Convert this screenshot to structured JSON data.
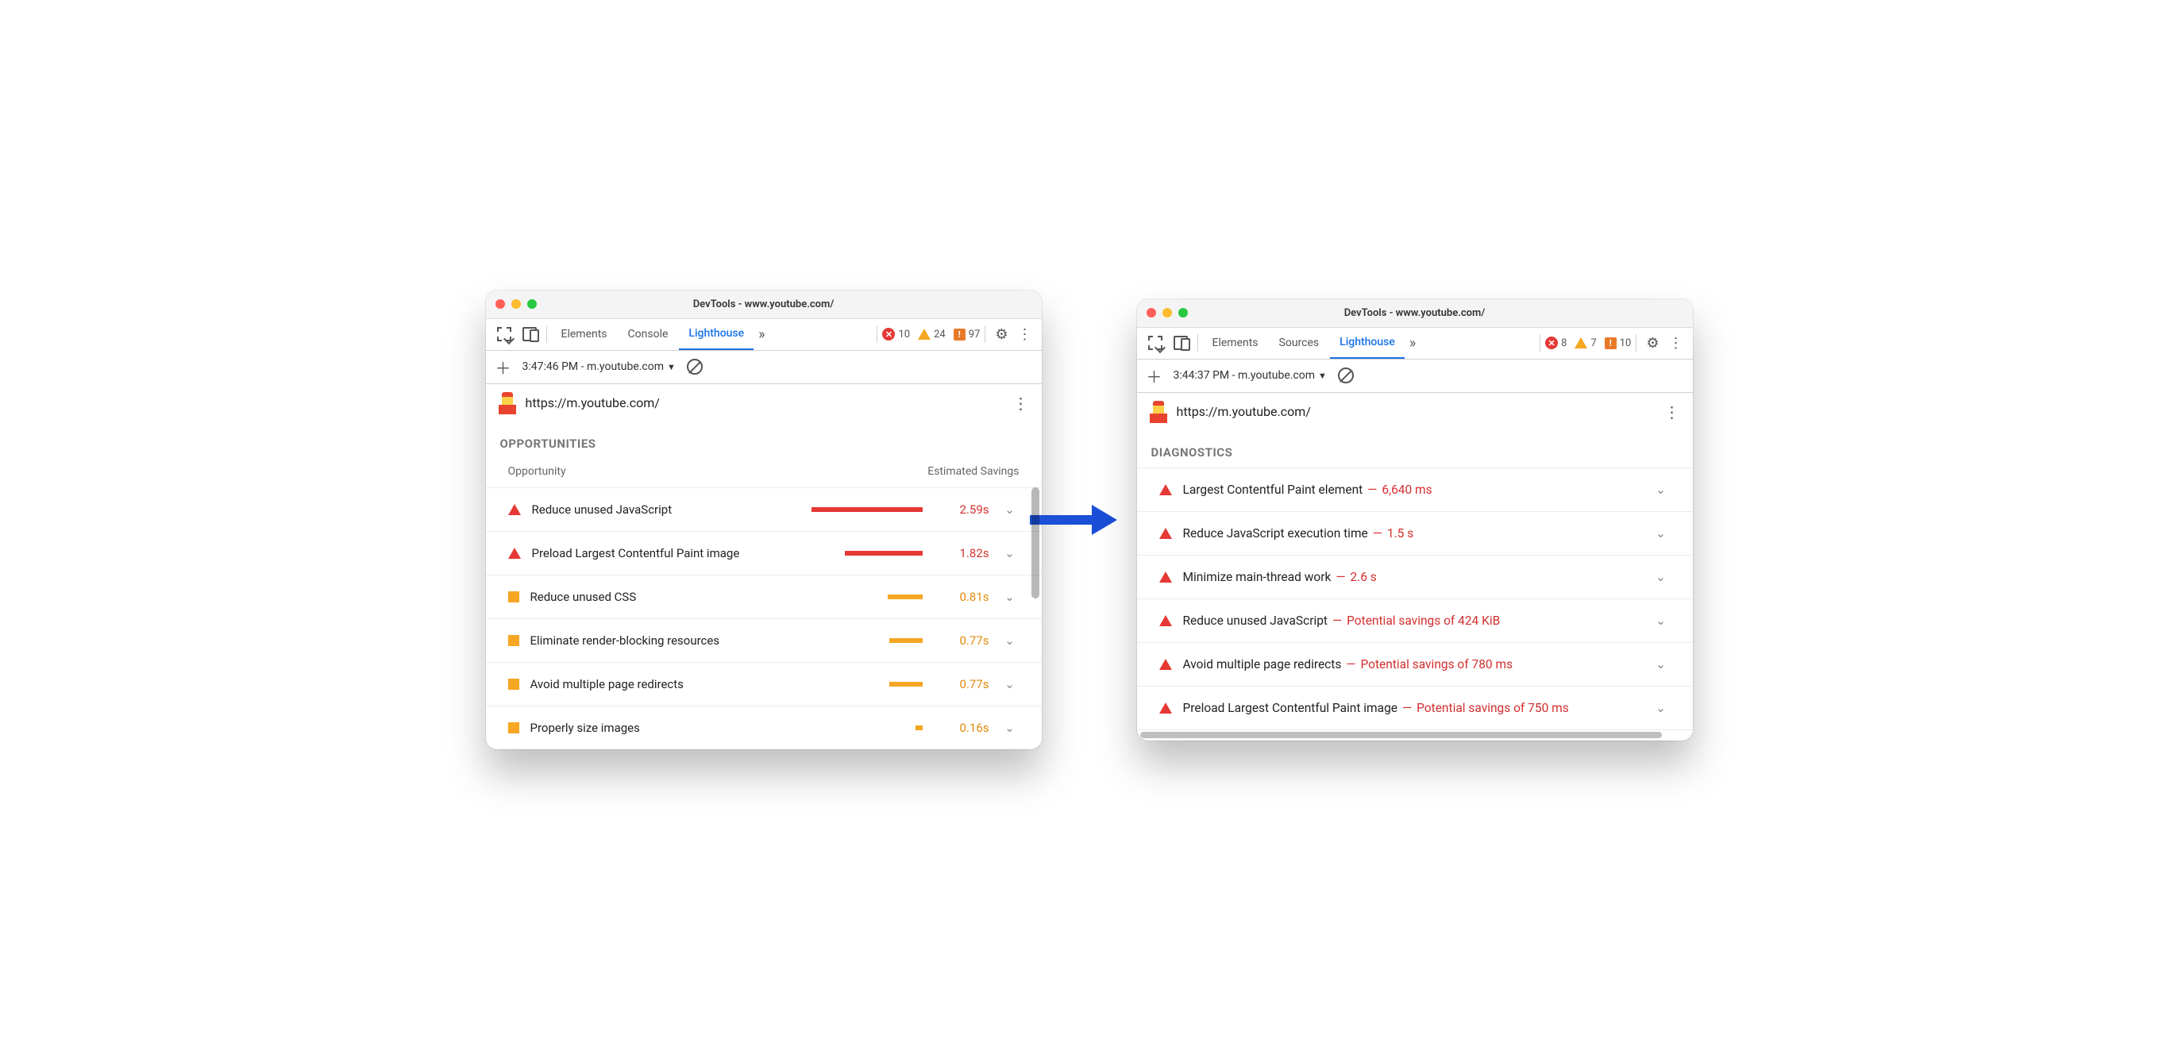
{
  "leftWindow": {
    "title": "DevTools - www.youtube.com/",
    "tabs": {
      "t1": "Elements",
      "t2": "Console",
      "t3": "Lighthouse"
    },
    "badges": {
      "errors": "10",
      "warnings": "24",
      "info": "97"
    },
    "run_label": "3:47:46 PM - m.youtube.com",
    "url": "https://m.youtube.com/",
    "section": "OPPORTUNITIES",
    "opp_head_left": "Opportunity",
    "opp_head_right": "Estimated Savings",
    "rows": [
      {
        "title": "Reduce unused JavaScript",
        "savings": "2.59s",
        "sev": "red",
        "barpct": 100
      },
      {
        "title": "Preload Largest Contentful Paint image",
        "savings": "1.82s",
        "sev": "red",
        "barpct": 70
      },
      {
        "title": "Reduce unused CSS",
        "savings": "0.81s",
        "sev": "or",
        "barpct": 31
      },
      {
        "title": "Eliminate render-blocking resources",
        "savings": "0.77s",
        "sev": "or",
        "barpct": 30
      },
      {
        "title": "Avoid multiple page redirects",
        "savings": "0.77s",
        "sev": "or",
        "barpct": 30
      },
      {
        "title": "Properly size images",
        "savings": "0.16s",
        "sev": "or",
        "barpct": 6
      }
    ]
  },
  "rightWindow": {
    "title": "DevTools - www.youtube.com/",
    "tabs": {
      "t1": "Elements",
      "t2": "Sources",
      "t3": "Lighthouse"
    },
    "badges": {
      "errors": "8",
      "warnings": "7",
      "info": "10"
    },
    "run_label": "3:44:37 PM - m.youtube.com",
    "url": "https://m.youtube.com/",
    "section": "DIAGNOSTICS",
    "rows": [
      {
        "title": "Largest Contentful Paint element",
        "value": "6,640 ms"
      },
      {
        "title": "Reduce JavaScript execution time",
        "value": "1.5 s"
      },
      {
        "title": "Minimize main-thread work",
        "value": "2.6 s"
      },
      {
        "title": "Reduce unused JavaScript",
        "value": "Potential savings of 424 KiB"
      },
      {
        "title": "Avoid multiple page redirects",
        "value": "Potential savings of 780 ms"
      },
      {
        "title": "Preload Largest Contentful Paint image",
        "value": "Potential savings of 750 ms"
      }
    ]
  }
}
